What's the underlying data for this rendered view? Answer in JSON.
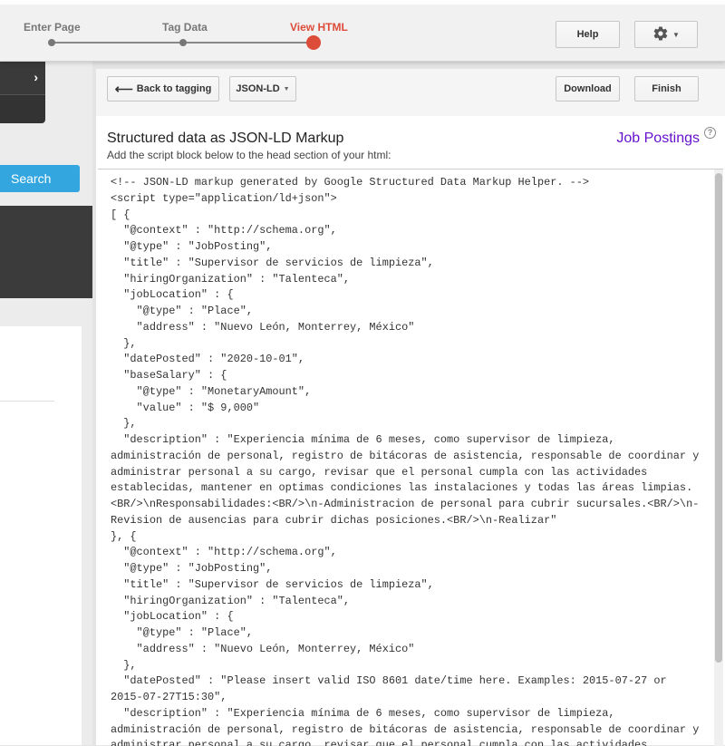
{
  "steps": [
    {
      "label": "Enter Page"
    },
    {
      "label": "Tag Data"
    },
    {
      "label": "View HTML"
    }
  ],
  "header": {
    "help_label": "Help",
    "settings_icon": "gear-icon"
  },
  "sidebar": {
    "search_label": "Search",
    "chevron_icon": "chevron-right-icon"
  },
  "toolbar": {
    "back_label": "Back to tagging",
    "back_icon": "arrow-left-icon",
    "format_label": "JSON-LD",
    "download_label": "Download",
    "finish_label": "Finish"
  },
  "content": {
    "title": "Structured data as JSON-LD Markup",
    "subtitle": "Add the script block below to the head section of your html:",
    "type_link": "Job Postings",
    "help_icon": "question-circle-icon"
  },
  "code": {
    "lines": [
      "<!-- JSON-LD markup generated by Google Structured Data Markup Helper. -->",
      "<script type=\"application/ld+json\">",
      "[ {",
      "  \"@context\" : \"http://schema.org\",",
      "  \"@type\" : \"JobPosting\",",
      "  \"title\" : \"Supervisor de servicios de limpieza\",",
      "  \"hiringOrganization\" : \"Talenteca\",",
      "  \"jobLocation\" : {",
      "    \"@type\" : \"Place\",",
      "    \"address\" : \"Nuevo León, Monterrey, México\"",
      "  },",
      "  \"datePosted\" : \"2020-10-01\",",
      "  \"baseSalary\" : {",
      "    \"@type\" : \"MonetaryAmount\",",
      "    \"value\" : \"$ 9,000\"",
      "  },",
      "  \"description\" : \"Experiencia mínima de 6 meses, como supervisor de limpieza,",
      "administración de personal, registro de bitácoras de asistencia, responsable de coordinar y",
      "administrar personal a su cargo, revisar que el personal cumpla con las actividades",
      "establecidas, mantener en optimas condiciones las instalaciones y todas las áreas limpias.",
      "<BR/>\\nResponsabilidades:<BR/>\\n-Administracion de personal para cubrir sucursales.<BR/>\\n-",
      "Revision de ausencias para cubrir dichas posiciones.<BR/>\\n-Realizar\"",
      "}, {",
      "  \"@context\" : \"http://schema.org\",",
      "  \"@type\" : \"JobPosting\",",
      "  \"title\" : \"Supervisor de servicios de limpieza\",",
      "  \"hiringOrganization\" : \"Talenteca\",",
      "  \"jobLocation\" : {",
      "    \"@type\" : \"Place\",",
      "    \"address\" : \"Nuevo León, Monterrey, México\"",
      "  },",
      "  \"datePosted\" : \"Please insert valid ISO 8601 date/time here. Examples: 2015-07-27 or",
      "2015-07-27T15:30\",",
      "  \"description\" : \"Experiencia mínima de 6 meses, como supervisor de limpieza,",
      "administración de personal, registro de bitácoras de asistencia, responsable de coordinar y",
      "administrar personal a su cargo, revisar que el personal cumpla con las actividades"
    ]
  }
}
